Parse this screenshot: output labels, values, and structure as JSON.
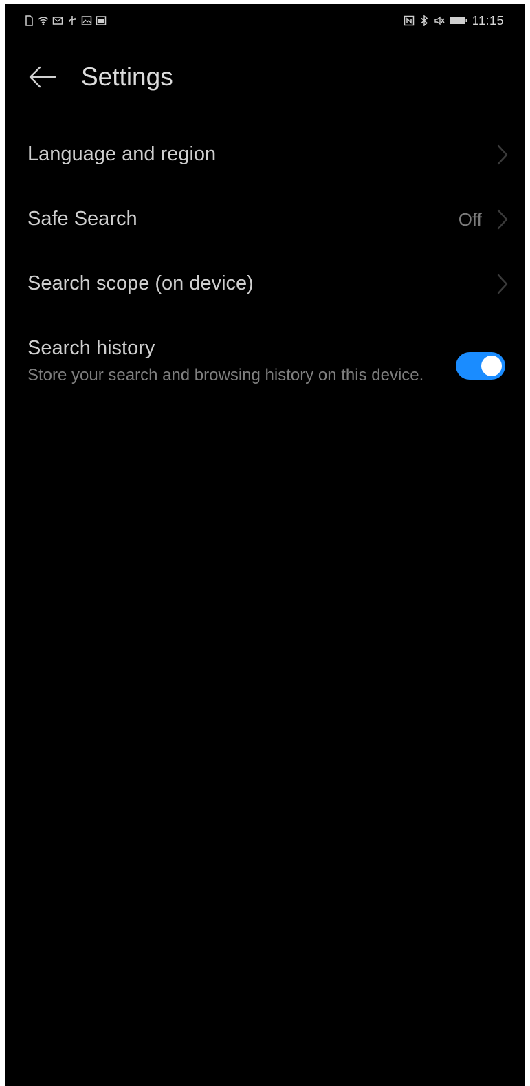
{
  "status_bar": {
    "time": "11:15",
    "left_icons": [
      "sim-card-icon",
      "wifi-icon",
      "message-icon",
      "usb-icon",
      "gallery-icon",
      "image-icon"
    ],
    "right_icons": [
      "nfc-icon",
      "bluetooth-icon",
      "mute-icon",
      "battery-icon"
    ]
  },
  "header": {
    "title": "Settings",
    "back_icon": "arrow-left-icon"
  },
  "settings": {
    "items": [
      {
        "label": "Language and region",
        "value": ""
      },
      {
        "label": "Safe Search",
        "value": "Off"
      },
      {
        "label": "Search scope (on device)",
        "value": ""
      }
    ],
    "history": {
      "title": "Search history",
      "description": "Store your search and browsing history on this device.",
      "toggle_on": true
    }
  },
  "colors": {
    "background": "#000000",
    "accent": "#1a8cff"
  }
}
